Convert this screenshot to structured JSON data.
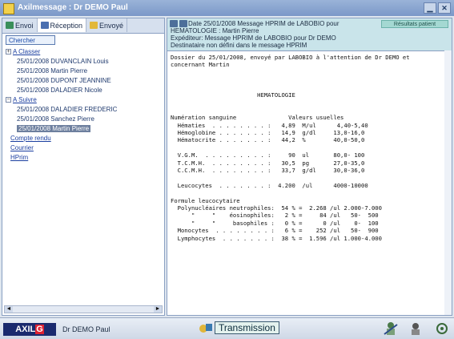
{
  "window": {
    "title": "Axilmessage : Dr DEMO Paul",
    "btn_min": "▁",
    "btn_close": "✕"
  },
  "left": {
    "tabs": [
      {
        "label": "Envoi",
        "icon": "send-icon",
        "color": "#3a8f5a"
      },
      {
        "label": "Réception",
        "icon": "inbox-icon",
        "color": "#4a6fb0"
      },
      {
        "label": "Envoyé",
        "icon": "sent-folder-icon",
        "color": "#e2b83a"
      }
    ],
    "search_label": "Chercher",
    "tree": [
      {
        "type": "cat",
        "expander": "+",
        "label": "A Classer"
      },
      {
        "type": "leaf",
        "label": "25/01/2008 DUVANCLAIN Louis"
      },
      {
        "type": "leaf",
        "label": "25/01/2008 Martin Pierre"
      },
      {
        "type": "leaf",
        "label": "25/01/2008 DUPONT JEANNINE"
      },
      {
        "type": "leaf",
        "label": "25/01/2008 DALADIER Nicole"
      },
      {
        "type": "cat",
        "expander": "−",
        "label": "A Suivre"
      },
      {
        "type": "leaf",
        "label": "25/01/2008 DALADIER FREDERIC"
      },
      {
        "type": "leaf",
        "label": "25/01/2008 Sanchez Pierre"
      },
      {
        "type": "leaf",
        "label": "25/01/2008 Martin Pierre",
        "selected": true
      },
      {
        "type": "link",
        "label": "Compte rendu"
      },
      {
        "type": "link",
        "label": "Courrier"
      },
      {
        "type": "link",
        "label": "HPrim"
      }
    ],
    "scroll_left": "◄",
    "scroll_right": "►"
  },
  "message": {
    "header_line1": "Date 25/01/2008    Message HPRIM de LABOBIO pour",
    "header_line2": "HEMATOLOGIE : Martin Pierre",
    "header_line3": "Expéditeur: Message HPRIM de LABOBIO pour Dr DEMO",
    "header_line4": "Destinataire non défini dans le message HPRIM",
    "badge": "Résultats patient",
    "body": [
      "Dossier du 25/01/2008, envoyé par LABOBIO à l'attention de Dr DEMO et",
      "concernant Martin",
      "",
      "",
      "",
      "                         HEMATOLOGIE",
      "",
      "",
      "Numération sanguine               Valeurs usuelles",
      "  Hématies  . . . . . . . . :   4,89  M/ul      4,40-5,40",
      "  Hémoglobine . . . . . . . :   14,9  g/dl     13,0-16,0",
      "  Hématocrite . . . . . . . :   44,2  %        40,0-50,0",
      "",
      "  V.G.M.  . . . . . . . . . :     90  ul       80,0- 100",
      "  T.C.M.H.  . . . . . . . . :   30,5  pg       27,0-35,0",
      "  C.C.M.H.  . . . . . . . . :   33,7  g/dl     30,0-36,0",
      "",
      "  Leucocytes  . . . . . . . :  4.200  /ul      4000-10000",
      "",
      "Formule leucocytaire",
      "  Polynucléaires neutrophiles:  54 % =  2.268 /ul 2.000-7.000",
      "      \"     \"    éosinophiles:   2 % =     84 /ul   50-  500",
      "      \"     \"     basophiles :   0 % =      0 /ul    0-  100",
      "  Monocytes  . . . . . . . . :   6 % =    252 /ul   50-  900",
      "  Lymphocytes  . . . . . . . :  38 % =  1.596 /ul 1.000-4.000"
    ]
  },
  "bottom": {
    "logo_a": "AXIL",
    "logo_g": "G",
    "logo_b": "",
    "user": "Dr DEMO Paul",
    "transmit_label": "Transmission"
  }
}
